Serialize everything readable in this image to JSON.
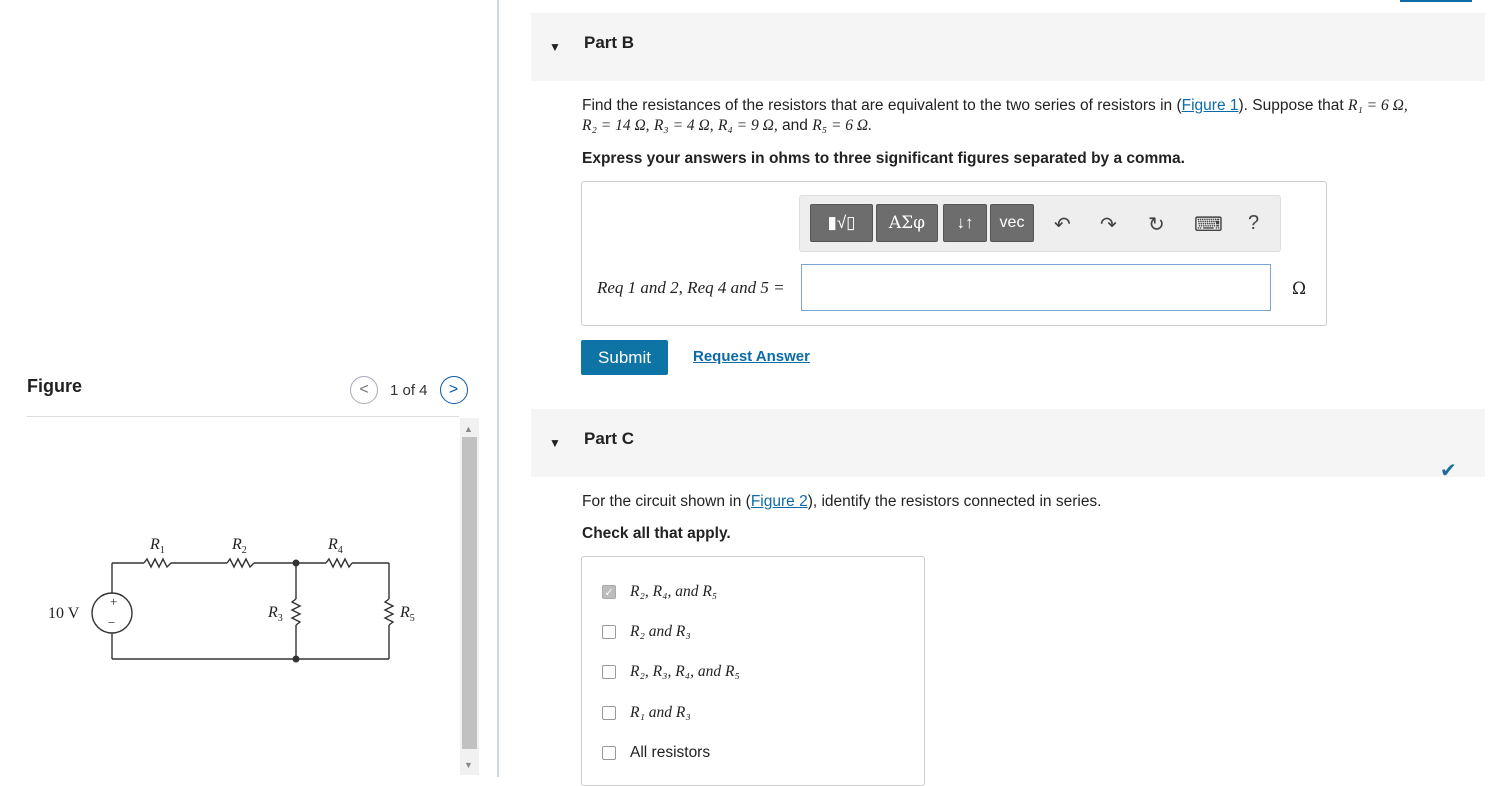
{
  "figure": {
    "title": "Figure",
    "pager": "1 of 4",
    "prev_glyph": "<",
    "next_glyph": ">",
    "circuit": {
      "source": "10 V",
      "source_plus": "+",
      "source_minus": "−",
      "r1": "R",
      "r1_sub": "1",
      "r2": "R",
      "r2_sub": "2",
      "r3": "R",
      "r3_sub": "3",
      "r4": "R",
      "r4_sub": "4",
      "r5": "R",
      "r5_sub": "5"
    }
  },
  "partB": {
    "title": "Part B",
    "question_pre": "Find the resistances of the resistors that are equivalent to the two series of resistors in (",
    "question_link": "Figure 1",
    "question_post": "). Suppose that ",
    "r1_eq": "R₁ = 6 Ω,",
    "r2_eq": "R₂ = 14 Ω,",
    "r3_eq": "R₃ = 4 Ω,",
    "r4_eq": "R₄ = 9 Ω,",
    "and": "and",
    "r5_eq": "R₅ = 6 Ω.",
    "instruction": "Express your answers in ohms to three significant figures separated by a comma.",
    "toolbar": {
      "templates": "▮√▯",
      "greek": "ΑΣφ",
      "arrows": "↓↑",
      "vec": "vec",
      "undo": "↶",
      "redo": "↷",
      "reset": "↻",
      "keyboard": "⌨",
      "help": "?"
    },
    "eq_label": "Req 1 and 2, Req 4 and 5 =",
    "answer_value": "",
    "unit": "Ω",
    "submit": "Submit",
    "request_answer": "Request Answer"
  },
  "partC": {
    "title": "Part C",
    "question_pre": "For the circuit shown in (",
    "question_link": "Figure 2",
    "question_post": "), identify the resistors connected in series.",
    "instruction": "Check all that apply.",
    "options": [
      {
        "label": "R₂, R₄, and R₅",
        "checked": true
      },
      {
        "label": "R₂ and R₃",
        "checked": false
      },
      {
        "label": "R₂, R₃, R₄, and R₅",
        "checked": false
      },
      {
        "label": "R₁ and R₃",
        "checked": false
      },
      {
        "label": "All resistors",
        "checked": false
      }
    ],
    "completed_icon": "check-icon"
  },
  "colors": {
    "primary": "#0d74a5",
    "link": "#0c6aa7",
    "header_bg": "#f5f5f5"
  }
}
